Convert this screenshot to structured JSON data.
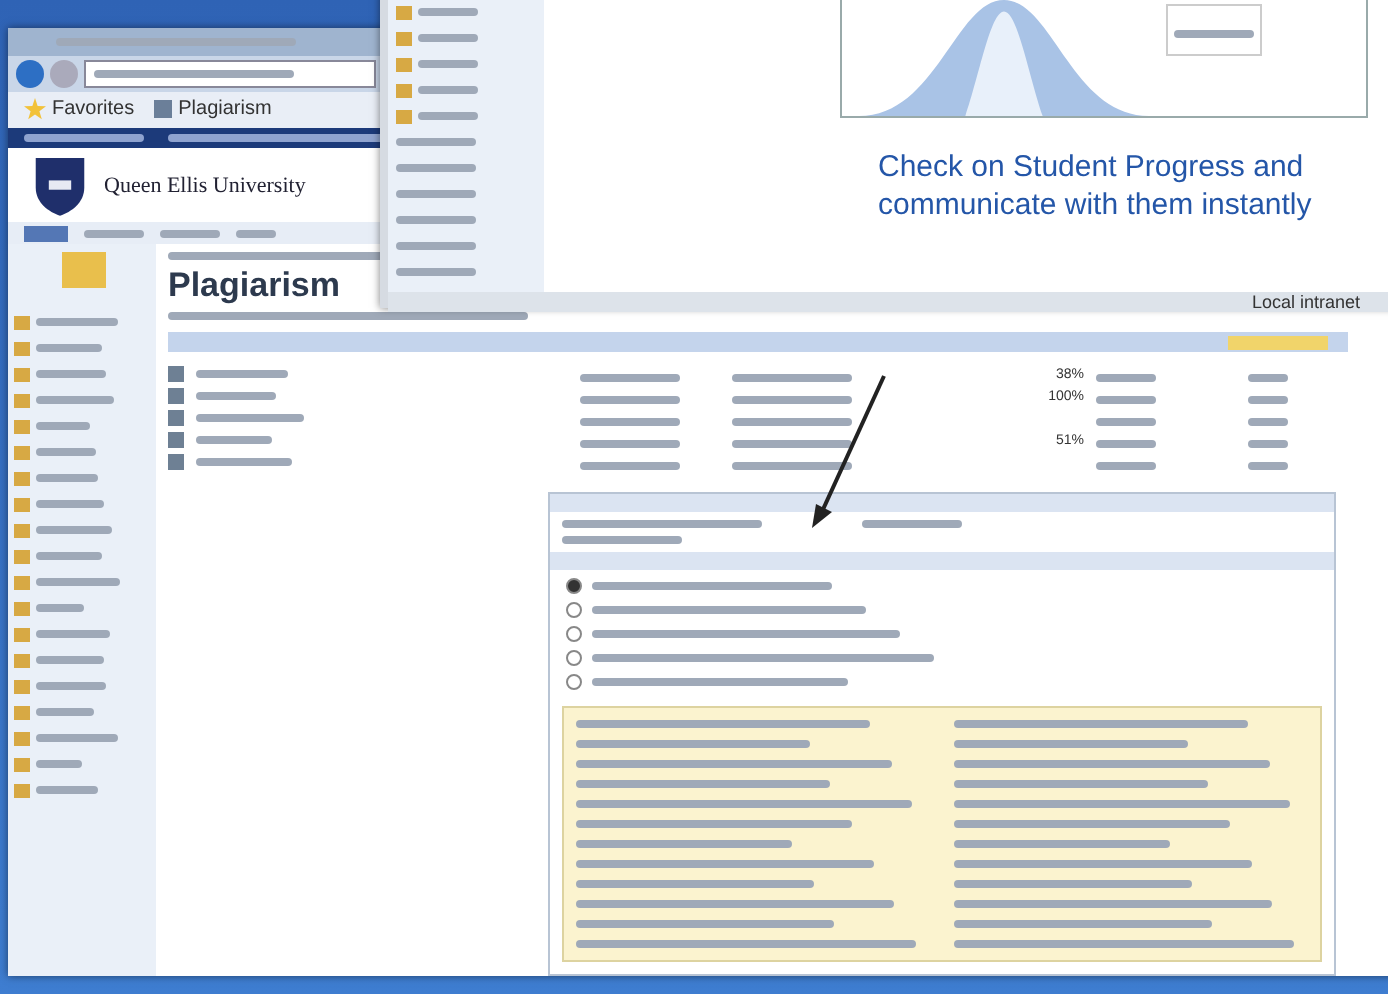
{
  "browser": {
    "favorites": "Favorites",
    "tab": "Plagiarism"
  },
  "site": {
    "name": "Queen Ellis University"
  },
  "page": {
    "title": "Plagiarism"
  },
  "rows": [
    {
      "similarity": "38%"
    },
    {
      "similarity": "100%"
    },
    {
      "similarity": ""
    },
    {
      "similarity": "51%"
    },
    {
      "similarity": ""
    }
  ],
  "sources": [
    {
      "selected": true
    },
    {
      "selected": false
    },
    {
      "selected": false
    },
    {
      "selected": false
    },
    {
      "selected": false
    }
  ],
  "overlay": {
    "caption": "Check on Student Progress and communicate with them instantly",
    "status": "Local intranet"
  }
}
